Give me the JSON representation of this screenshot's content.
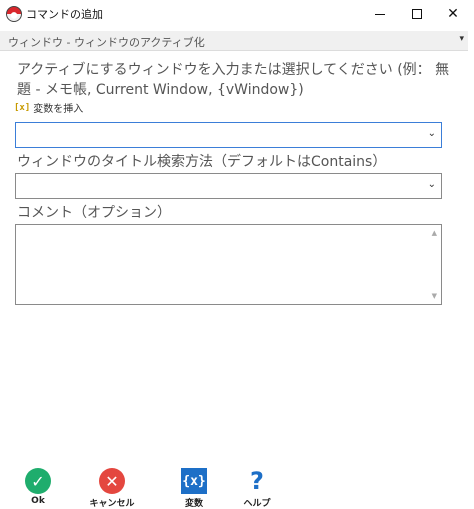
{
  "window": {
    "title": "コマンドの追加",
    "minimize_icon": "minimize-icon",
    "maximize_icon": "maximize-icon",
    "close_label": "✕"
  },
  "section": {
    "title": "ウィンドウ - ウィンドウのアクティブ化",
    "chevron": "▾"
  },
  "form": {
    "window_prompt": "アクティブにするウィンドウを入力または選択してください (例： 無題 - メモ帳, Current Window, {vWindow})",
    "insert_variable_icon": "[x]",
    "insert_variable_label": "変数を挿入",
    "window_value": "",
    "method_label": "ウィンドウのタイトル検索方法（デフォルトはContains）",
    "method_value": "",
    "comment_label": "コメント（オプション）",
    "comment_value": ""
  },
  "toolbar": {
    "ok_label": "Ok",
    "ok_glyph": "✓",
    "cancel_label": "キャンセル",
    "cancel_glyph": "✕",
    "variables_label": "変数",
    "variables_glyph": "{x}",
    "help_label": "ヘルプ",
    "help_glyph": "?"
  },
  "colors": {
    "ok": "#1fad6d",
    "cancel": "#e4473f",
    "accent": "#1d6fc7",
    "focus_border": "#3b7ed8"
  }
}
